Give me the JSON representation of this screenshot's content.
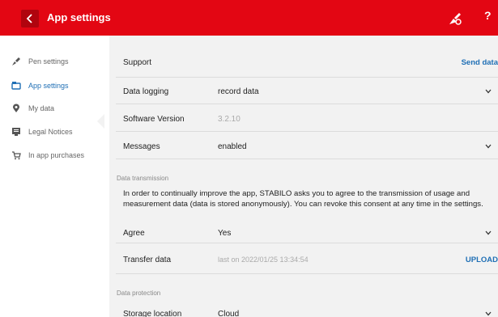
{
  "header": {
    "title": "App settings",
    "help": "?"
  },
  "sidebar": {
    "items": [
      {
        "label": "Pen settings",
        "icon": "pen-icon",
        "active": false
      },
      {
        "label": "App settings",
        "icon": "app-settings-icon",
        "active": true
      },
      {
        "label": "My data",
        "icon": "location-pin-icon",
        "active": false
      },
      {
        "label": "Legal Notices",
        "icon": "legal-icon",
        "active": false
      },
      {
        "label": "In app purchases",
        "icon": "cart-icon",
        "active": false
      }
    ]
  },
  "settings": {
    "support": {
      "label": "Support",
      "action": "Send data"
    },
    "data_logging": {
      "label": "Data logging",
      "value": "record data"
    },
    "software_version": {
      "label": "Software Version",
      "value": "3.2.10"
    },
    "messages": {
      "label": "Messages",
      "value": "enabled"
    },
    "data_transmission": {
      "heading": "Data transmission",
      "consent_text": "In order to continually improve the app, STABILO asks you to agree to the transmission of usage and measurement data (data is stored anonymously). You can revoke this consent at any time in the settings.",
      "agree": {
        "label": "Agree",
        "value": "Yes"
      },
      "transfer": {
        "label": "Transfer data",
        "value": "last on 2022/01/25 13:34:54",
        "action": "UPLOAD"
      }
    },
    "data_protection": {
      "heading": "Data protection",
      "storage": {
        "label": "Storage location",
        "value": "Cloud"
      }
    }
  },
  "colors": {
    "brand_red": "#e30613",
    "accent_blue": "#1f6fb5",
    "panel_bg": "#f2f2f2"
  }
}
